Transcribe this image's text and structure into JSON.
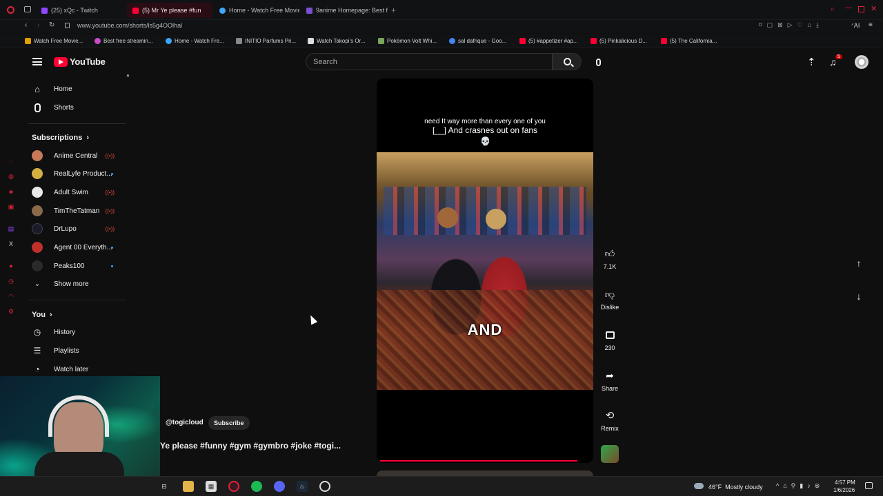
{
  "browser": {
    "tabs": [
      {
        "label": "(25) xQc - Twitch",
        "color": "#9146ff"
      },
      {
        "label": "(5) Mr Ye please #fun",
        "color": "#ff0033"
      },
      {
        "label": "Home - Watch Free Movie",
        "color": "#3ea6ff"
      },
      {
        "label": "9anime Homepage: Best f",
        "color": "#7b4fd0"
      }
    ],
    "address": "www.youtube.com/shorts/ls5g4OOlhal",
    "bookmarks": [
      {
        "label": "Watch Free Movie...",
        "color": "#e0a000"
      },
      {
        "label": "Best free streamin...",
        "color": "#c94cc9"
      },
      {
        "label": "Home - Watch Fre...",
        "color": "#3ea6ff"
      },
      {
        "label": "INITIO Parfums Pri...",
        "color": "#888888"
      },
      {
        "label": "Watch Takopi's Or...",
        "color": "#dddddd"
      },
      {
        "label": "Pokémon Volt Whi...",
        "color": "#7aa65a"
      },
      {
        "label": "sal dafrique - Goo...",
        "color": "#4285f4"
      },
      {
        "label": "(5) #appetizer #ap...",
        "color": "#ff0033"
      },
      {
        "label": "(5) Pinkalicious D...",
        "color": "#ff0033"
      },
      {
        "label": "(5) The California...",
        "color": "#ff0033"
      }
    ]
  },
  "youtube": {
    "logo": "YouTube",
    "search_placeholder": "Search",
    "notifications_count": "5"
  },
  "sidebar": {
    "main": [
      {
        "label": "Home",
        "icon": "home-icon"
      },
      {
        "label": "Shorts",
        "icon": "shorts-icon"
      }
    ],
    "subscriptions_title": "Subscriptions",
    "subscriptions": [
      {
        "label": "Anime Central",
        "status": "live",
        "color": "#c87a5a"
      },
      {
        "label": "RealLyfe Product...",
        "status": "new",
        "color": "#d4b040"
      },
      {
        "label": "Adult Swim",
        "status": "live",
        "color": "#e8e8e8"
      },
      {
        "label": "TimTheTatman",
        "status": "live",
        "color": "#8a6a4a"
      },
      {
        "label": "DrLupo",
        "status": "live",
        "color": "#1a1a2a"
      },
      {
        "label": "Agent 00 Everyth...",
        "status": "new",
        "color": "#c0302a"
      },
      {
        "label": "Peaks100",
        "status": "new",
        "color": "#2a2a2a"
      }
    ],
    "show_more": "Show more",
    "you_title": "You",
    "you_items": [
      {
        "label": "History",
        "icon": "history-icon"
      },
      {
        "label": "Playlists",
        "icon": "playlists-icon"
      },
      {
        "label": "Watch later",
        "icon": "watch-later-icon"
      }
    ]
  },
  "short": {
    "caption_line1": "need It way more than every one of you",
    "caption_line2": "[__] And crasnes out on fans",
    "overlay_word": "AND",
    "channel": "@togicloud",
    "subscribe": "Subscribe",
    "title": "Ye please #funny #gym #gymbro #joke #togi...",
    "progress": 0.91
  },
  "actions": {
    "likes": "7.1K",
    "dislike": "Dislike",
    "comments": "230",
    "share": "Share",
    "remix": "Remix"
  },
  "taskbar": {
    "weather": "46°F  Mostly cloudy",
    "time": "4:57 PM",
    "date": "1/6/2026"
  }
}
